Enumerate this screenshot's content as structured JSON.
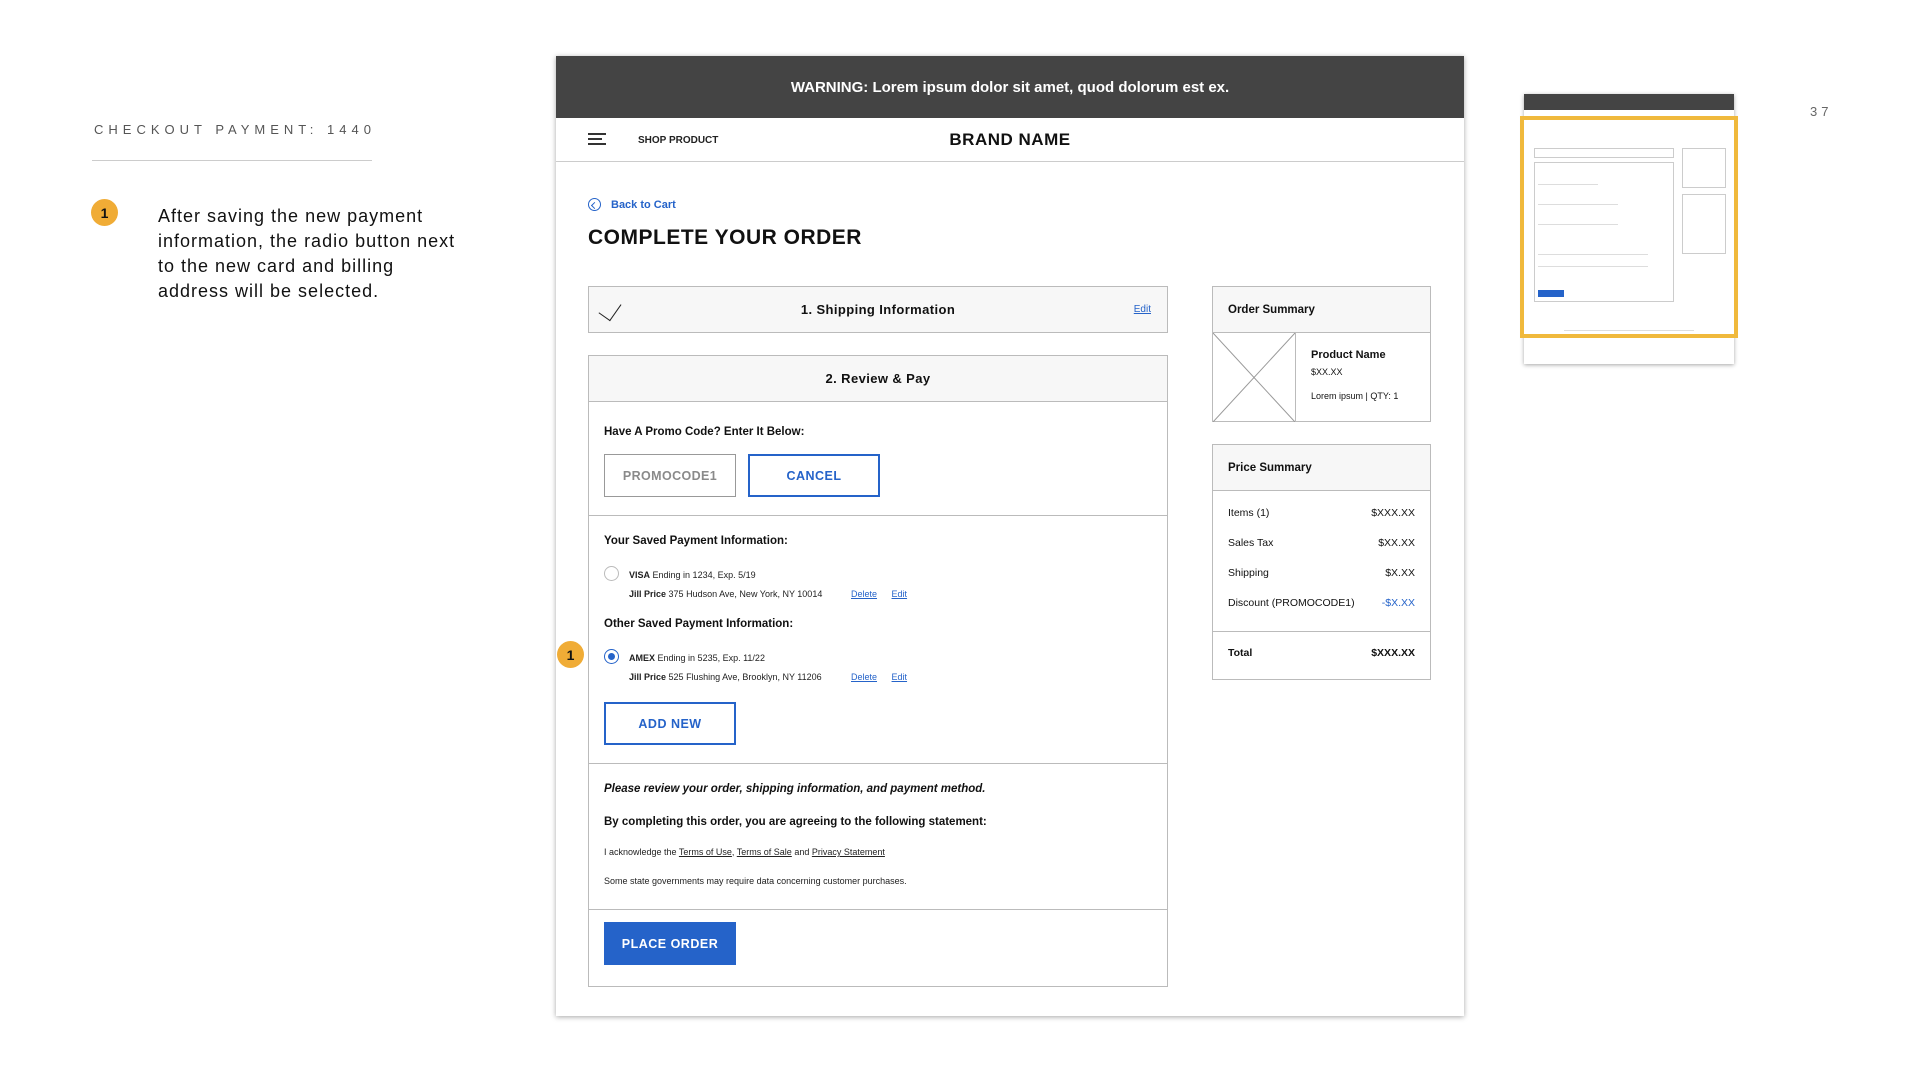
{
  "slide": {
    "label": "CHECKOUT PAYMENT: 1440",
    "page_number": "37",
    "note_badge": "1",
    "note_text": "After saving the new payment information, the radio button next to the new card and billing address will be selected."
  },
  "mockup": {
    "warning": "WARNING: Lorem ipsum dolor sit amet, quod dolorum est ex.",
    "header": {
      "shop_link": "SHOP PRODUCT",
      "brand": "BRAND NAME"
    },
    "back_link": "Back to Cart",
    "page_title": "COMPLETE YOUR ORDER",
    "shipping": {
      "title": "1. Shipping Information",
      "edit": "Edit"
    },
    "review": {
      "title": "2. Review & Pay",
      "promo_label": "Have A Promo Code? Enter It Below:",
      "promo_value": "PROMOCODE1",
      "cancel": "CANCEL",
      "saved_label": "Your Saved Payment Information:",
      "saved_card_brand": "VISA",
      "saved_card_detail": "Ending in 1234, Exp. 5/19",
      "saved_name": "Jill Price",
      "saved_address": "375 Hudson Ave, New York, NY 10014",
      "other_label": "Other Saved Payment Information:",
      "other_card_brand": "AMEX",
      "other_card_detail": "Ending in 5235, Exp. 11/22",
      "other_name": "Jill Price",
      "other_address": "525 Flushing Ave, Brooklyn, NY 11206",
      "delete": "Delete",
      "edit": "Edit",
      "add_new": "ADD NEW",
      "review_note": "Please review your order, shipping information, and payment method.",
      "agree_note": "By completing this order, you are agreeing to the following statement:",
      "ack_prefix": "I acknowledge the",
      "terms_use": "Terms of Use",
      "comma": ",",
      "terms_sale": "Terms of Sale",
      "and": "and",
      "privacy": "Privacy Statement",
      "state_note": "Some state governments may require data concerning customer purchases.",
      "place_order": "PLACE ORDER"
    },
    "order_summary": {
      "title": "Order Summary",
      "product_name": "Product Name",
      "product_price": "$XX.XX",
      "product_meta": "Lorem ipsum | QTY: 1"
    },
    "price_summary": {
      "title": "Price Summary",
      "rows": [
        {
          "label": "Items (1)",
          "value": "$XXX.XX"
        },
        {
          "label": "Sales Tax",
          "value": "$XX.XX"
        },
        {
          "label": "Shipping",
          "value": "$X.XX"
        },
        {
          "label": "Discount (PROMOCODE1)",
          "value": "-$X.XX"
        }
      ],
      "total_label": "Total",
      "total_value": "$XXX.XX"
    }
  },
  "colors": {
    "accent": "#2563c9",
    "annotation": "#f0ac36",
    "warning_bg": "#444444"
  }
}
